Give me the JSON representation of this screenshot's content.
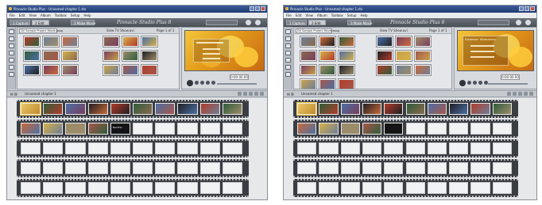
{
  "window_a": {
    "title": "Pinnacle Studio Plus - Unnamed chapter 1.stx",
    "menu": [
      "File",
      "Edit",
      "View",
      "Album",
      "Toolbox",
      "Setup",
      "Help"
    ],
    "tabs": [
      "1 Capture",
      "2 Edit",
      "3 Make Movie"
    ],
    "brand": "Pinnacle Studio Plus 8",
    "album": {
      "dropdown": "DV Sample Project Movie.mpg",
      "scene_label": "Slow TV Show.avi",
      "page_label": "Page 1 of 1"
    },
    "counter": "0:00:00.00",
    "timeline_title": "Unnamed chapter 1",
    "clip_label": "Bad Ext"
  },
  "window_b": {
    "title": "Pinnacle Studio Plus - Unnamed chapter 1.stx",
    "menu": [
      "File",
      "Edit",
      "View",
      "Album",
      "Toolbox",
      "Setup",
      "Help"
    ],
    "tabs": [
      "1 Capture",
      "2 Edit",
      "3 Make Movie"
    ],
    "brand": "Pinnacle Studio Plus 8",
    "album": {
      "dropdown": "DV Sample Project Movie.mpg",
      "scene_label": "Slow TV Show.avi",
      "page_label": "Page 1 of 1"
    },
    "counter": "0:00:00.00",
    "timeline_title": "Unnamed chapter 1",
    "disc_menu_title": "Summer Memories"
  },
  "colors": {
    "clip_palette": [
      "#b23b2a",
      "#6f7f96",
      "#c96a3a",
      "#2f5d3a",
      "#8a6a4f",
      "#d5b04a",
      "#4b6fa5",
      "#7a3e5e",
      "#9c8c6a",
      "#1f1f22",
      "#c8a14c",
      "#a6574a"
    ]
  }
}
